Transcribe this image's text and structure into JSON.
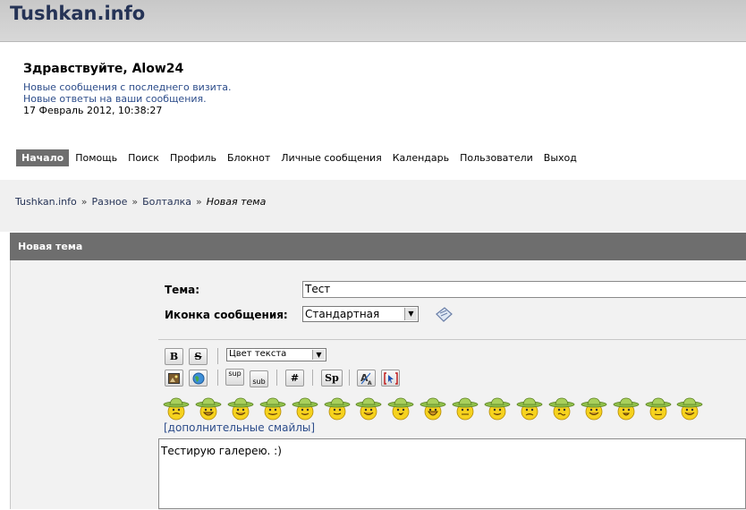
{
  "header": {
    "logo": "Tushkan.info"
  },
  "welcome": {
    "greeting": "Здравствуйте, Alow24",
    "new_since_visit": "Новые сообщения с последнего визита.",
    "new_replies": "Новые ответы на ваши сообщения.",
    "datetime": "17 Февраль 2012, 10:38:27"
  },
  "nav": [
    "Начало",
    "Помощь",
    "Поиск",
    "Профиль",
    "Блокнот",
    "Личные сообщения",
    "Календарь",
    "Пользователи",
    "Выход"
  ],
  "breadcrumb": {
    "items": [
      "Tushkan.info",
      "Разное",
      "Болталка"
    ],
    "current": "Новая тема",
    "sep": "»"
  },
  "title_bar": "Новая тема",
  "form": {
    "subject_label": "Тема:",
    "subject_value": "Тест",
    "icon_label": "Иконка сообщения:",
    "icon_value": "Стандартная",
    "color_select": "Цвет текста",
    "more_smileys": "[дополнительные смайлы]",
    "message": "Тестирую галерею.  :)"
  },
  "toolbar": {
    "bold": "B",
    "strike": "S",
    "sup": "sup",
    "sub": "sub",
    "hash": "#",
    "sp": "Sp"
  },
  "colors": {
    "header_bg": "#d0d0d0",
    "logo": "#253356",
    "bar": "#6e6e6e",
    "link": "#2c4c8a"
  },
  "smileys": [
    "angry-smiley",
    "grin-smiley",
    "tongue-smiley",
    "wink-smiley",
    "cool-smiley",
    "smile-smiley",
    "happy-smiley",
    "surprised-smiley",
    "laugh-smiley",
    "neutral-smiley",
    "eyes-smiley",
    "sad-smiley",
    "confused-smiley",
    "content-smiley",
    "shocked-smiley",
    "sleepy-smiley",
    "lol-smiley"
  ]
}
